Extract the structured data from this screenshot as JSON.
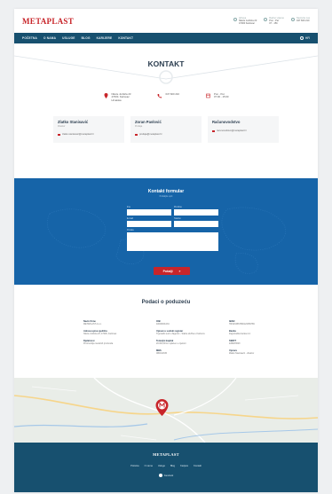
{
  "brand": {
    "logo": "METAPLAST"
  },
  "top_contacts": [
    {
      "label": "Adresa",
      "line1": "Nikole Jurišića 23",
      "line2": "47000 Karlovac"
    },
    {
      "label": "Radno vrijeme",
      "line1": "Pon - Pet",
      "line2": "07 - 15h"
    },
    {
      "label": "Nazovite nas",
      "line1": "047 600 210",
      "line2": ""
    }
  ],
  "nav": {
    "items": [
      "POČETNA",
      "O NAMA",
      "USLUGE",
      "BLOG",
      "KARIJERE",
      "KONTAKT"
    ],
    "lang": "HR"
  },
  "hero": {
    "title": "KONTAKT"
  },
  "info": {
    "address": [
      "Nikole Jurišića 23",
      "47000, Karlovac",
      "Hrvatska"
    ],
    "phone": "047 600 210",
    "hours": [
      "Pon - Pet",
      "07:00 - 15:00"
    ]
  },
  "contacts": [
    {
      "name": "Zlatko Stanisavić",
      "role": "Direktor",
      "email": "zlatko.stanisavic@metaplast.hr"
    },
    {
      "name": "Zoran Pavlović",
      "role": "Prodaja",
      "email": "prodaja@metaplast.hr"
    },
    {
      "name": "Računovodstvo",
      "role": "",
      "email": "racunovodstvo@metaplast.hr"
    }
  ],
  "form": {
    "title": "Kontakt formular",
    "subtitle": "Pošaljite upit",
    "fields": {
      "name": "Ime",
      "surname": "Prezime",
      "email": "E-mail",
      "phone": "Telefon",
      "message": "Poruka"
    },
    "send": "Pošalji",
    "send_arrow": "»"
  },
  "company": {
    "title": "Podaci o poduzeću",
    "col1": [
      {
        "k": "Naziv firme",
        "v": "METAPLAST d.o.o."
      },
      {
        "k": "Adresa upisa sjedišta",
        "v": "Nikole Jurišića 23, 47000, Karlovac"
      },
      {
        "k": "Djelatnost",
        "v": "Proizvodnja metalnih proizvoda"
      }
    ],
    "col2": [
      {
        "k": "OIB",
        "v": "40000001234"
      },
      {
        "k": "Upisan u sudski registar",
        "v": "Trgovački sud u Zagrebu - Stalna služba u Karlovcu"
      },
      {
        "k": "Temeljni kapital",
        "v": "20.000,00 kn uplaćen u cijelosti"
      },
      {
        "k": "MBS",
        "v": "080012345"
      }
    ],
    "col3": [
      {
        "k": "IBAN",
        "v": "HR1234567890123456789"
      },
      {
        "k": "Banka",
        "v": "Zagrebačka banka d.d."
      },
      {
        "k": "SWIFT",
        "v": "ZABAHR2X"
      },
      {
        "k": "Uprava",
        "v": "Zlatko Stanisavić - direktor"
      }
    ]
  },
  "footer": {
    "logo": "METAPLAST",
    "links": [
      "Početna",
      "O nama",
      "Usluge",
      "Blog",
      "Karijere",
      "Kontakt"
    ],
    "social": "Facebook"
  }
}
